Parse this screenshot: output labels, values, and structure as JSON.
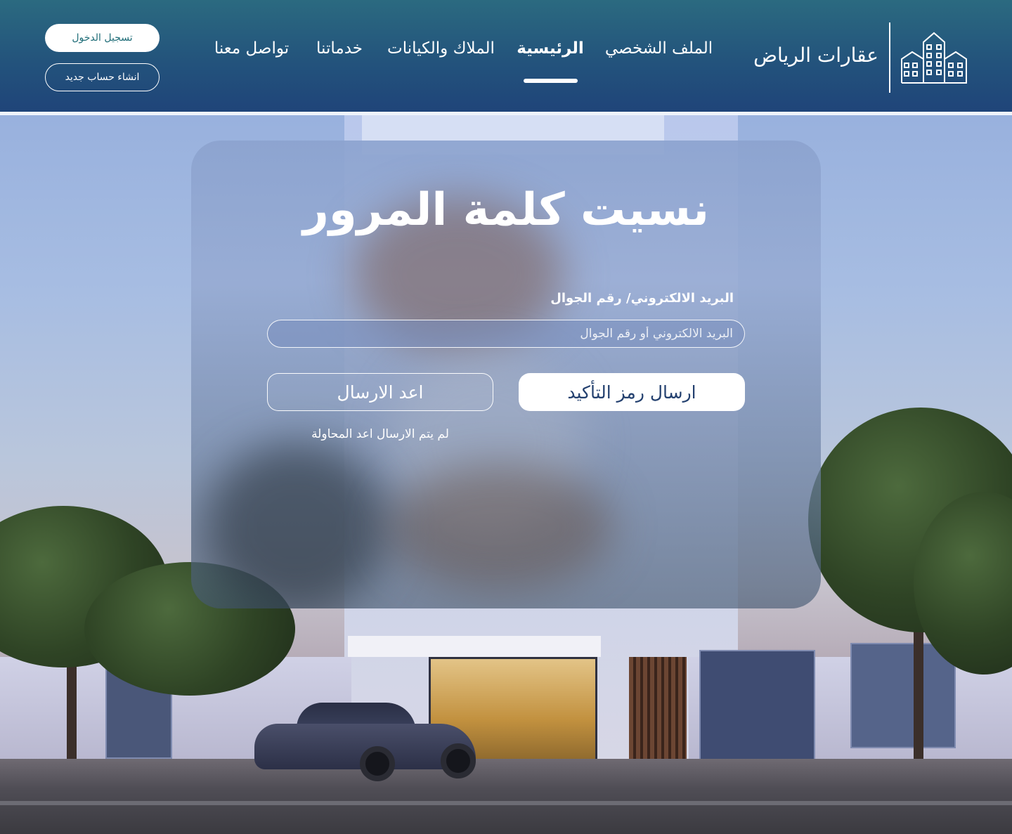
{
  "header": {
    "brand": "عقارات الرياض",
    "nav": [
      {
        "label": "الملف الشخصي"
      },
      {
        "label": "الرئيسية"
      },
      {
        "label": "الملاك والكيانات"
      },
      {
        "label": "خدماتنا"
      },
      {
        "label": "تواصل معنا"
      }
    ],
    "login_label": "تسجيل الدخول",
    "register_label": "انشاء حساب جديد"
  },
  "card": {
    "title": "نسيت كلمة المرور",
    "field_label": "البريد الالكتروني/ رقم الجوال",
    "field_placeholder": "البريد الالكتروني أو رقم الجوال",
    "send_label": "ارسال رمز التأكيد",
    "resend_label": "اعد الارسال",
    "retry_note": "لم يتم الارسال اعد المحاولة"
  },
  "colors": {
    "header_top": "#2b6a80",
    "header_bottom": "#1f4479",
    "login_text": "#1f6d78",
    "send_text": "#23406f"
  },
  "icons": {
    "logo": "buildings-icon"
  }
}
